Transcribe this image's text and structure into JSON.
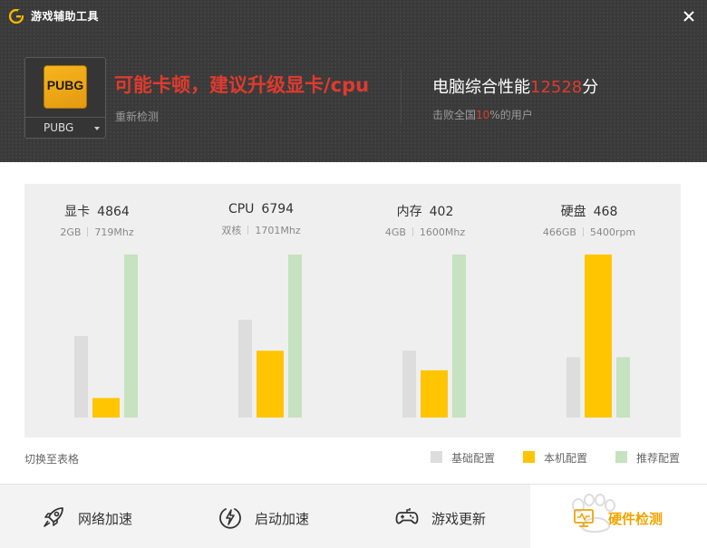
{
  "app": {
    "title": "游戏辅助工具",
    "logo_icon": "g-logo-icon",
    "close_icon": "close-icon"
  },
  "game": {
    "logo_text": "PUBG",
    "name": "PUBG"
  },
  "status": {
    "headline": "可能卡顿，建议升级显卡/cpu",
    "recheck": "重新检测",
    "score_prefix": "电脑综合性能",
    "score": "12528",
    "score_suffix": "分",
    "beat_prefix": "击败全国",
    "beat_pct": "10",
    "beat_suffix": "%的用户"
  },
  "colors": {
    "base": "#dddddd",
    "local": "#ffc500",
    "recommended": "#c6e2c0",
    "accent_red": "#e03a2e",
    "active_text": "#f0a500"
  },
  "chart_data": {
    "type": "bar",
    "categories": [
      "显卡",
      "CPU",
      "内存",
      "硬盘"
    ],
    "scores": [
      "4864",
      "6794",
      "402",
      "468"
    ],
    "specs": [
      [
        "2GB",
        "719Mhz"
      ],
      [
        "双核",
        "1701Mhz"
      ],
      [
        "4GB",
        "1600Mhz"
      ],
      [
        "466GB",
        "5400rpm"
      ]
    ],
    "series": [
      {
        "name": "基础配置",
        "values": [
          0.5,
          0.6,
          0.41,
          0.37
        ]
      },
      {
        "name": "本机配置",
        "values": [
          0.12,
          0.41,
          0.29,
          1.0
        ]
      },
      {
        "name": "推荐配置",
        "values": [
          1.0,
          1.0,
          1.0,
          0.37
        ]
      }
    ],
    "ylim": [
      0,
      1
    ],
    "legend_position": "bottom-right",
    "grid": false
  },
  "switch_table": "切换至表格",
  "nav": [
    {
      "label": "网络加速",
      "icon": "rocket-icon"
    },
    {
      "label": "启动加速",
      "icon": "lightning-icon"
    },
    {
      "label": "游戏更新",
      "icon": "gamepad-icon"
    },
    {
      "label": "硬件检测",
      "icon": "hardware-icon"
    }
  ]
}
